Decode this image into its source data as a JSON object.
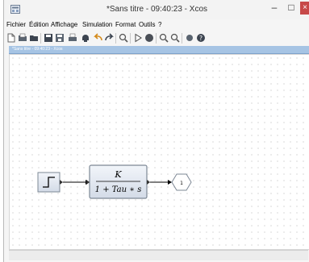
{
  "window": {
    "title": "*Sans titre - 09:40:23 - Xcos",
    "app_icon": "xcos-app-icon",
    "controls": {
      "minimize": "–",
      "maximize": "□",
      "close": "×"
    }
  },
  "menu": {
    "items": [
      "Fichier",
      "Édition",
      "Affichage",
      "Simulation",
      "Format",
      "Outils",
      "?"
    ]
  },
  "toolbar": {
    "buttons": [
      "new-diagram-icon",
      "open-icon",
      "open-folder-icon",
      "save-icon",
      "save-as-icon",
      "print-icon",
      "delete-icon",
      "undo-icon",
      "redo-icon",
      "fit-diagram-icon",
      "start-simulation-icon",
      "stop-simulation-icon",
      "zoom-in-icon",
      "zoom-out-icon",
      "palette-browser-icon",
      "help-icon"
    ]
  },
  "tab": {
    "label": "*Sans titre - 09:40:23 - Xcos"
  },
  "diagram": {
    "blocks": [
      {
        "type": "STEP_FUNCTION",
        "icon": "step-icon"
      },
      {
        "type": "CLR",
        "numerator": "K",
        "denominator": "1 + Tau ∗ s"
      },
      {
        "type": "OUT_f",
        "port_number": "1"
      }
    ],
    "colors": {
      "block_fill": "#dfe6f0",
      "block_border": "#7d8895",
      "link": "#000000"
    }
  }
}
